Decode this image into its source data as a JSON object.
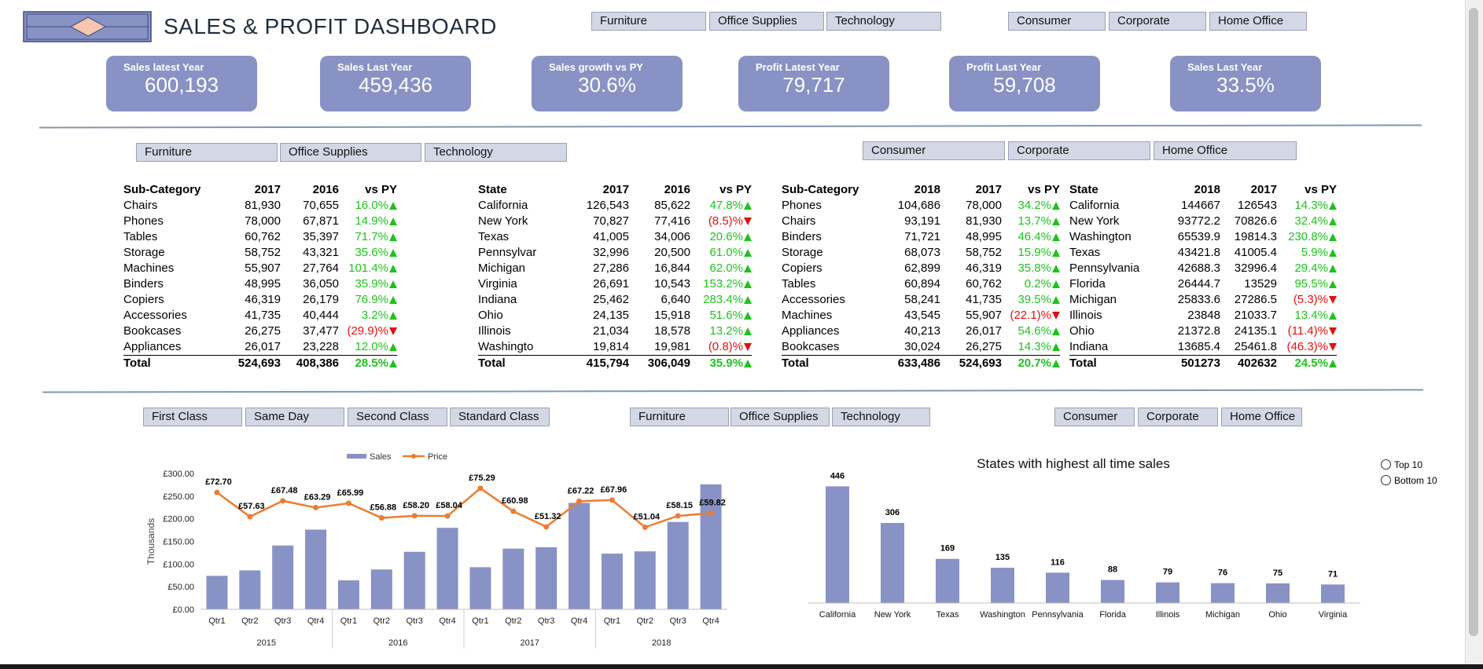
{
  "header": {
    "title": "SALES & PROFIT DASHBOARD",
    "category_slicer": [
      "Furniture",
      "Office Supplies",
      "Technology"
    ],
    "segment_slicer": [
      "Consumer",
      "Corporate",
      "Home Office"
    ]
  },
  "kpis": [
    {
      "label": "Sales latest Year",
      "value": "600,193"
    },
    {
      "label": "Sales Last Year",
      "value": "459,436"
    },
    {
      "label": "Sales growth vs PY",
      "value": "30.6%"
    },
    {
      "label": "Profit Latest Year",
      "value": "79,717"
    },
    {
      "label": "Profit Last Year",
      "value": "59,708"
    },
    {
      "label": "Sales Last Year",
      "value": "33.5%"
    }
  ],
  "section2": {
    "category_slicer": [
      "Furniture",
      "Office Supplies",
      "Technology"
    ],
    "segment_slicer": [
      "Consumer",
      "Corporate",
      "Home Office"
    ]
  },
  "tables": [
    {
      "headers": [
        "Sub-Category",
        "2017",
        "2016",
        "vs PY"
      ],
      "rows": [
        [
          "Chairs",
          "81,930",
          "70,655",
          "16.0%",
          "up"
        ],
        [
          "Phones",
          "78,000",
          "67,871",
          "14.9%",
          "up"
        ],
        [
          "Tables",
          "60,762",
          "35,397",
          "71.7%",
          "up"
        ],
        [
          "Storage",
          "58,752",
          "43,321",
          "35.6%",
          "up"
        ],
        [
          "Machines",
          "55,907",
          "27,764",
          "101.4%",
          "up"
        ],
        [
          "Binders",
          "48,995",
          "36,050",
          "35.9%",
          "up"
        ],
        [
          "Copiers",
          "46,319",
          "26,179",
          "76.9%",
          "up"
        ],
        [
          "Accessories",
          "41,735",
          "40,444",
          "3.2%",
          "up"
        ],
        [
          "Bookcases",
          "26,275",
          "37,477",
          "(29.9)%",
          "down"
        ],
        [
          "Appliances",
          "26,017",
          "23,228",
          "12.0%",
          "up"
        ]
      ],
      "total": [
        "Total",
        "524,693",
        "408,386",
        "28.5%",
        "up"
      ]
    },
    {
      "headers": [
        "State",
        "2017",
        "2016",
        "vs PY"
      ],
      "rows": [
        [
          "California",
          "126,543",
          "85,622",
          "47.8%",
          "up"
        ],
        [
          "New York",
          "70,827",
          "77,416",
          "(8.5)%",
          "down"
        ],
        [
          "Texas",
          "41,005",
          "34,006",
          "20.6%",
          "up"
        ],
        [
          "Pennsylvar",
          "32,996",
          "20,500",
          "61.0%",
          "up"
        ],
        [
          "Michigan",
          "27,286",
          "16,844",
          "62.0%",
          "up"
        ],
        [
          "Virginia",
          "26,691",
          "10,543",
          "153.2%",
          "up"
        ],
        [
          "Indiana",
          "25,462",
          "6,640",
          "283.4%",
          "up"
        ],
        [
          "Ohio",
          "24,135",
          "15,918",
          "51.6%",
          "up"
        ],
        [
          "Illinois",
          "21,034",
          "18,578",
          "13.2%",
          "up"
        ],
        [
          "Washingto",
          "19,814",
          "19,981",
          "(0.8)%",
          "down"
        ]
      ],
      "total": [
        "Total",
        "415,794",
        "306,049",
        "35.9%",
        "up"
      ]
    },
    {
      "headers": [
        "Sub-Category",
        "2018",
        "2017",
        "vs PY"
      ],
      "rows": [
        [
          "Phones",
          "104,686",
          "78,000",
          "34.2%",
          "up"
        ],
        [
          "Chairs",
          "93,191",
          "81,930",
          "13.7%",
          "up"
        ],
        [
          "Binders",
          "71,721",
          "48,995",
          "46.4%",
          "up"
        ],
        [
          "Storage",
          "68,073",
          "58,752",
          "15.9%",
          "up"
        ],
        [
          "Copiers",
          "62,899",
          "46,319",
          "35.8%",
          "up"
        ],
        [
          "Tables",
          "60,894",
          "60,762",
          "0.2%",
          "up"
        ],
        [
          "Accessories",
          "58,241",
          "41,735",
          "39.5%",
          "up"
        ],
        [
          "Machines",
          "43,545",
          "55,907",
          "(22.1)%",
          "down"
        ],
        [
          "Appliances",
          "40,213",
          "26,017",
          "54.6%",
          "up"
        ],
        [
          "Bookcases",
          "30,024",
          "26,275",
          "14.3%",
          "up"
        ]
      ],
      "total": [
        "Total",
        "633,486",
        "524,693",
        "20.7%",
        "up"
      ]
    },
    {
      "headers": [
        "State",
        "2018",
        "2017",
        "vs PY"
      ],
      "rows": [
        [
          "California",
          "144667",
          "126543",
          "14.3%",
          "up"
        ],
        [
          "New York",
          "93772.2",
          "70826.6",
          "32.4%",
          "up"
        ],
        [
          "Washington",
          "65539.9",
          "19814.3",
          "230.8%",
          "up"
        ],
        [
          "Texas",
          "43421.8",
          "41005.4",
          "5.9%",
          "up"
        ],
        [
          "Pennsylvania",
          "42688.3",
          "32996.4",
          "29.4%",
          "up"
        ],
        [
          "Florida",
          "26444.7",
          "13529",
          "95.5%",
          "up"
        ],
        [
          "Michigan",
          "25833.6",
          "27286.5",
          "(5.3)%",
          "down"
        ],
        [
          "Illinois",
          "23848",
          "21033.7",
          "13.4%",
          "up"
        ],
        [
          "Ohio",
          "21372.8",
          "24135.1",
          "(11.4)%",
          "down"
        ],
        [
          "Indiana",
          "13685.4",
          "25461.8",
          "(46.3)%",
          "down"
        ]
      ],
      "total": [
        "Total",
        "501273",
        "402632",
        "24.5%",
        "up"
      ]
    }
  ],
  "section3": {
    "ship_mode_slicer": [
      "First Class",
      "Same Day",
      "Second Class",
      "Standard Class"
    ],
    "category_slicer": [
      "Furniture",
      "Office Supplies",
      "Technology"
    ],
    "segment_slicer": [
      "Consumer",
      "Corporate",
      "Home Office"
    ]
  },
  "radio_options": [
    "Top 10",
    "Bottom 10"
  ],
  "colors": {
    "accent": "#8892c4",
    "bar": "#8892c4",
    "line": "#ed7d31",
    "up": "#1ec21e",
    "down": "#e01010",
    "rule": "#8496b0"
  },
  "chart_data": [
    {
      "type": "bar",
      "combo": "bar+line",
      "legend": [
        "Sales",
        "Price"
      ],
      "legend_position": "top",
      "ylabel": "Thousands",
      "y_ticks": [
        "£300.00",
        "£250.00",
        "£200.00",
        "£150.00",
        "£100.00",
        "£50.00",
        "£0.00"
      ],
      "ylim": [
        0,
        300
      ],
      "categories": [
        "Qtr1",
        "Qtr2",
        "Qtr3",
        "Qtr4",
        "Qtr1",
        "Qtr2",
        "Qtr3",
        "Qtr4",
        "Qtr1",
        "Qtr2",
        "Qtr3",
        "Qtr4",
        "Qtr1",
        "Qtr2",
        "Qtr3",
        "Qtr4"
      ],
      "years": [
        "2015",
        "2016",
        "2017",
        "2018"
      ],
      "series": [
        {
          "name": "Sales",
          "values": [
            74,
            86,
            141,
            176,
            64,
            88,
            127,
            180,
            93,
            134,
            137,
            235,
            123,
            128,
            193,
            276
          ]
        },
        {
          "name": "Price",
          "values": [
            72.7,
            57.63,
            67.48,
            63.29,
            65.99,
            56.88,
            58.2,
            58.04,
            75.29,
            60.98,
            51.32,
            67.22,
            67.96,
            51.04,
            58.15,
            59.82
          ],
          "labels": [
            "£72.70",
            "£57.63",
            "£67.48",
            "£63.29",
            "£65.99",
            "£56.88",
            "£58.20",
            "£58.04",
            "£75.29",
            "£60.98",
            "£51.32",
            "£67.22",
            "£67.96",
            "£51.04",
            "£58.15",
            "£59.82"
          ]
        }
      ],
      "grid": false
    },
    {
      "type": "bar",
      "title": "States with highest all time sales",
      "categories": [
        "California",
        "New York",
        "Texas",
        "Washington",
        "Pennsylvania",
        "Florida",
        "Illinois",
        "Michigan",
        "Ohio",
        "Virginia"
      ],
      "values": [
        446,
        306,
        169,
        135,
        116,
        88,
        79,
        76,
        75,
        71
      ],
      "ylim": [
        0,
        500
      ],
      "grid": false
    }
  ]
}
